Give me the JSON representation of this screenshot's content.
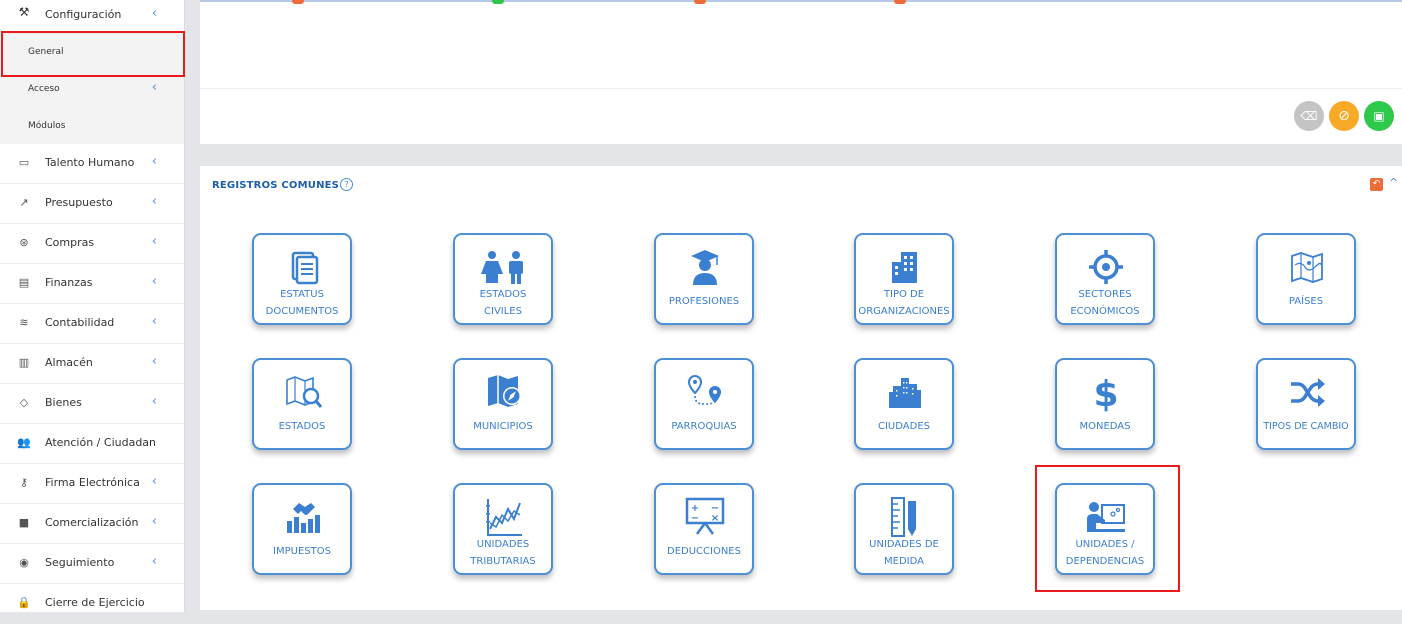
{
  "sidebar": {
    "config": {
      "label": "Configuración"
    },
    "sub": [
      {
        "label": "General"
      },
      {
        "label": "Acceso"
      },
      {
        "label": "Módulos"
      }
    ],
    "items": [
      {
        "label": "Talento Humano",
        "icon": "folder-icon"
      },
      {
        "label": "Presupuesto",
        "icon": "trend-icon"
      },
      {
        "label": "Compras",
        "icon": "box-icon"
      },
      {
        "label": "Finanzas",
        "icon": "calculator-icon"
      },
      {
        "label": "Contabilidad",
        "icon": "layers-icon"
      },
      {
        "label": "Almacén",
        "icon": "warehouse-icon"
      },
      {
        "label": "Bienes",
        "icon": "tag-icon"
      },
      {
        "label": "Atención / Ciudadanía",
        "icon": "users-icon"
      },
      {
        "label": "Firma Electrónica",
        "icon": "key-icon"
      },
      {
        "label": "Comercialización",
        "icon": "briefcase-icon"
      },
      {
        "label": "Seguimiento",
        "icon": "globe-icon"
      },
      {
        "label": "Cierre de Ejercicio",
        "icon": "lock-icon"
      }
    ]
  },
  "panel": {
    "title": "REGISTROS COMUNES",
    "help": "?"
  },
  "tiles": [
    {
      "l1": "ESTATUS",
      "l2": "DOCUMENTOS"
    },
    {
      "l1": "ESTADOS",
      "l2": "CIVILES"
    },
    {
      "l1": "PROFESIONES",
      "l2": ""
    },
    {
      "l1": "TIPO DE",
      "l2": "ORGANIZACIONES"
    },
    {
      "l1": "SECTORES",
      "l2": "ECONÓMICOS"
    },
    {
      "l1": "PAÍSES",
      "l2": ""
    },
    {
      "l1": "ESTADOS",
      "l2": ""
    },
    {
      "l1": "MUNICIPIOS",
      "l2": ""
    },
    {
      "l1": "PARROQUIAS",
      "l2": ""
    },
    {
      "l1": "CIUDADES",
      "l2": ""
    },
    {
      "l1": "MONEDAS",
      "l2": ""
    },
    {
      "l1": "TIPOS DE CAMBIO",
      "l2": ""
    },
    {
      "l1": "IMPUESTOS",
      "l2": ""
    },
    {
      "l1": "UNIDADES",
      "l2": "TRIBUTARIAS"
    },
    {
      "l1": "DEDUCCIONES",
      "l2": ""
    },
    {
      "l1": "UNIDADES DE",
      "l2": "MEDIDA"
    },
    {
      "l1": "UNIDADES /",
      "l2": "DEPENDENCIAS"
    }
  ],
  "colors": {
    "accent": "#4d8fd6",
    "highlight": "#e81b1b",
    "save": "#2ec84a",
    "cancel": "#f9a928",
    "clear": "#c4c4c4"
  }
}
